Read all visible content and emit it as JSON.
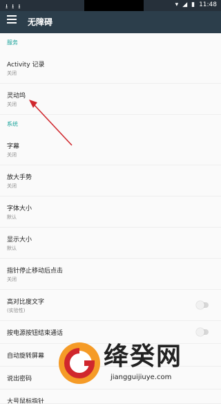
{
  "statusbar": {
    "time": "11:48",
    "icons_left": [
      "download-icon",
      "download-icon",
      "download-icon"
    ],
    "icons_right": [
      "wifi-icon",
      "signal-icon",
      "battery-icon"
    ]
  },
  "appbar": {
    "title": "无障碍"
  },
  "sections": [
    {
      "label": "服务",
      "items": [
        {
          "title": "Activity 记录",
          "subtitle": "关闭"
        },
        {
          "title": "灵动坞",
          "subtitle": "关闭"
        }
      ]
    },
    {
      "label": "系统",
      "items": [
        {
          "title": "字幕",
          "subtitle": "关闭"
        },
        {
          "title": "放大手势",
          "subtitle": "关闭"
        },
        {
          "title": "字体大小",
          "subtitle": "默认"
        },
        {
          "title": "显示大小",
          "subtitle": "默认"
        },
        {
          "title": "指针停止移动后点击",
          "subtitle": "关闭"
        },
        {
          "title": "高对比度文字",
          "subtitle": "(实验性)",
          "toggle": false
        },
        {
          "title": "按电源按钮结束通话",
          "toggle": false
        },
        {
          "title": "自动旋转屏幕"
        },
        {
          "title": "说出密码"
        },
        {
          "title": "大号鼠标指针"
        }
      ]
    }
  ],
  "watermark": {
    "brand": "绛癸网",
    "url": "jiangguijiuye.com"
  },
  "colors": {
    "statusbar": "#26303a",
    "appbar": "#2c3e4b",
    "section": "#1aa39b",
    "annotation": "#d0272d"
  }
}
